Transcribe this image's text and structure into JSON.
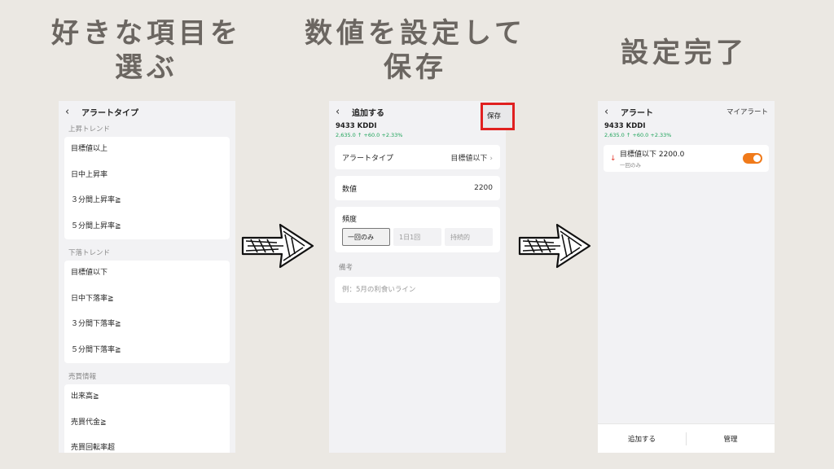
{
  "headings": {
    "step1_line1": "好きな項目を",
    "step1_line2": "選ぶ",
    "step2_line1": "数値を設定して",
    "step2_line2": "保存",
    "step3": "設定完了"
  },
  "panel1": {
    "title": "アラートタイプ",
    "sections": [
      {
        "title": "上昇トレンド",
        "items": [
          "目標値以上",
          "日中上昇率",
          "３分間上昇率≧",
          "５分間上昇率≧"
        ]
      },
      {
        "title": "下落トレンド",
        "items": [
          "目標値以下",
          "日中下落率≧",
          "３分間下落率≧",
          "５分間下落率≧"
        ]
      },
      {
        "title": "売買情報",
        "items": [
          "出来高≧",
          "売買代金≧",
          "売買回転率超"
        ]
      }
    ]
  },
  "panel2": {
    "title": "追加する",
    "save_label": "保存",
    "stock_name": "9433  KDDI",
    "stock_price": "2,635.0 ↑ +60.0 +2.33%",
    "alert_type_label": "アラートタイプ",
    "alert_type_value": "目標値以下",
    "number_label": "数値",
    "number_value": "2200",
    "frequency_label": "頻度",
    "frequency_options": [
      "一回のみ",
      "1日1回",
      "持続的"
    ],
    "frequency_selected": "一回のみ",
    "note_label": "備考",
    "note_placeholder": "例：5月の利食いライン"
  },
  "panel3": {
    "title": "アラート",
    "my_alerts_link": "マイアラート",
    "stock_name": "9433  KDDI",
    "stock_price": "2,635.0 ↑ +60.0 +2.33%",
    "alert_name": "目標値以下 2200.0",
    "alert_freq": "一回のみ",
    "alert_enabled": true,
    "add_button": "追加する",
    "manage_button": "管理"
  },
  "colors": {
    "background": "#ebe8e3",
    "heading": "#6b6661",
    "price_up": "#1fa35a",
    "toggle_on": "#f07a1a",
    "highlight_border": "#e02020"
  }
}
